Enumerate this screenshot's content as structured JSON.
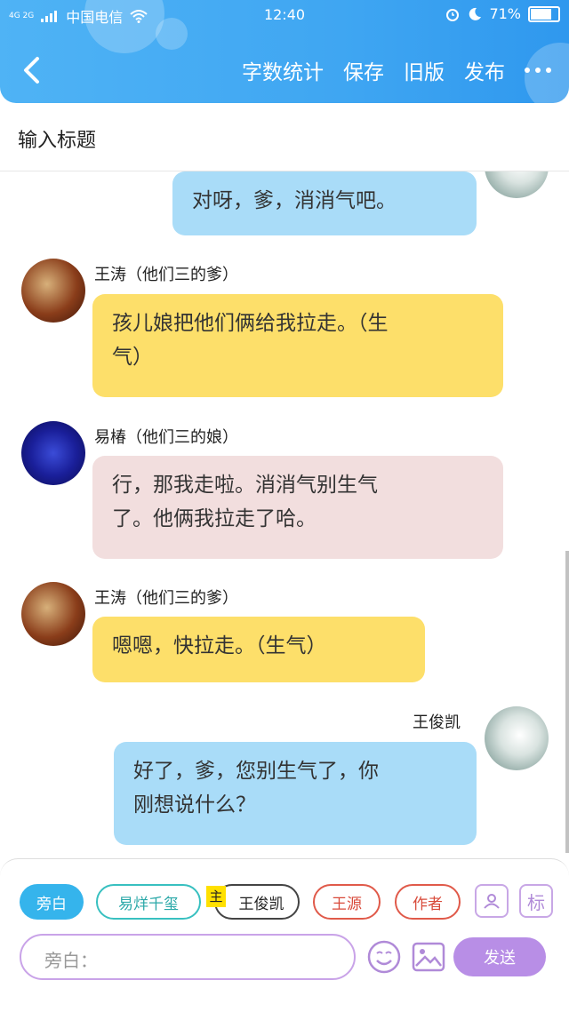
{
  "status": {
    "network": "4G 2G",
    "carrier": "中国电信",
    "time": "12:40",
    "battery": "71%",
    "battery_level": 0.71
  },
  "toolbar": {
    "word_count": "字数统计",
    "save": "保存",
    "old_version": "旧版",
    "publish": "发布"
  },
  "title_placeholder": "输入标题",
  "messages": [
    {
      "text": "对呀，爹，消消气吧。"
    },
    {
      "name": "王涛（他们三的爹）",
      "line1": "孩儿娘把他们俩给我拉走。（生",
      "line2": "气）"
    },
    {
      "name": "易椿（他们三的娘）",
      "line1": "行，那我走啦。消消气别生气",
      "line2": "了。他俩我拉走了哈。"
    },
    {
      "name": "王涛（他们三的爹）",
      "text": "嗯嗯，快拉走。（生气）"
    },
    {
      "name": "王俊凯",
      "line1": "好了，爹，您别生气了，你",
      "line2": "刚想说什么？"
    }
  ],
  "roles": {
    "narration": "旁白",
    "role1": "易烊千玺",
    "main_badge": "主",
    "role2": "王俊凯",
    "role3": "王源",
    "role4": "作者"
  },
  "icons": {
    "tag": "标"
  },
  "composer": {
    "placeholder": "旁白：",
    "send": "发送"
  },
  "colors": {
    "header": "#3fa6f2",
    "blue_bubble": "#a9dcf8",
    "yellow_bubble": "#fddf6a",
    "pink_bubble": "#f2dede",
    "send": "#b88ee6"
  }
}
